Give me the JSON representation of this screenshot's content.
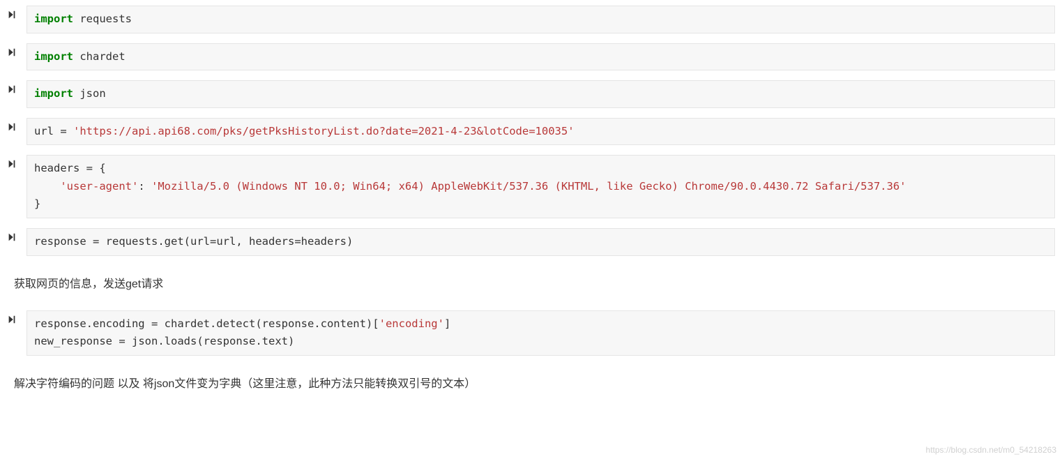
{
  "cells": [
    {
      "type": "code",
      "tokens": [
        {
          "t": "import ",
          "c": "kw-import"
        },
        {
          "t": "requests",
          "c": "kw-plain"
        }
      ]
    },
    {
      "type": "code",
      "tokens": [
        {
          "t": "import ",
          "c": "kw-import"
        },
        {
          "t": "chardet",
          "c": "kw-plain"
        }
      ]
    },
    {
      "type": "code",
      "tokens": [
        {
          "t": "import ",
          "c": "kw-import"
        },
        {
          "t": "json",
          "c": "kw-plain"
        }
      ]
    },
    {
      "type": "code",
      "tokens": [
        {
          "t": "url ",
          "c": "kw-plain"
        },
        {
          "t": "= ",
          "c": "op"
        },
        {
          "t": "'https://api.api68.com/pks/getPksHistoryList.do?date=2021-4-23&lotCode=10035'",
          "c": "str"
        }
      ]
    },
    {
      "type": "code",
      "tokens": [
        {
          "t": "headers ",
          "c": "kw-plain"
        },
        {
          "t": "= {",
          "c": "op"
        },
        {
          "t": "\n",
          "c": "kw-plain"
        },
        {
          "t": "    ",
          "c": "kw-plain"
        },
        {
          "t": "'user-agent'",
          "c": "str"
        },
        {
          "t": ": ",
          "c": "op"
        },
        {
          "t": "'Mozilla/5.0 (Windows NT 10.0; Win64; x64) AppleWebKit/537.36 (KHTML, like Gecko) Chrome/90.0.4430.72 Safari/537.36'",
          "c": "str"
        },
        {
          "t": "\n",
          "c": "kw-plain"
        },
        {
          "t": "}",
          "c": "op"
        }
      ]
    },
    {
      "type": "code",
      "tokens": [
        {
          "t": "response ",
          "c": "kw-plain"
        },
        {
          "t": "= ",
          "c": "op"
        },
        {
          "t": "requests.get",
          "c": "kw-plain"
        },
        {
          "t": "(",
          "c": "paren"
        },
        {
          "t": "url",
          "c": "kw-plain"
        },
        {
          "t": "=",
          "c": "op"
        },
        {
          "t": "url, headers",
          "c": "kw-plain"
        },
        {
          "t": "=",
          "c": "op"
        },
        {
          "t": "headers",
          "c": "kw-plain"
        },
        {
          "t": ")",
          "c": "paren"
        }
      ]
    },
    {
      "type": "markdown",
      "text": "获取网页的信息，发送get请求"
    },
    {
      "type": "code",
      "tokens": [
        {
          "t": "response.encoding ",
          "c": "kw-plain"
        },
        {
          "t": "= ",
          "c": "op"
        },
        {
          "t": "chardet.detect",
          "c": "kw-plain"
        },
        {
          "t": "(",
          "c": "paren"
        },
        {
          "t": "response.content",
          "c": "kw-plain"
        },
        {
          "t": ")[",
          "c": "paren"
        },
        {
          "t": "'encoding'",
          "c": "str"
        },
        {
          "t": "]",
          "c": "paren"
        },
        {
          "t": "\n",
          "c": "kw-plain"
        },
        {
          "t": "new_response ",
          "c": "kw-plain"
        },
        {
          "t": "= ",
          "c": "op"
        },
        {
          "t": "json.loads",
          "c": "kw-plain"
        },
        {
          "t": "(",
          "c": "paren"
        },
        {
          "t": "response.text",
          "c": "kw-plain"
        },
        {
          "t": ")",
          "c": "paren"
        }
      ]
    },
    {
      "type": "markdown",
      "text": "解决字符编码的问题 以及 将json文件变为字典（这里注意，此种方法只能转换双引号的文本）"
    }
  ],
  "watermark": "https://blog.csdn.net/m0_54218263",
  "icon_name": "run-cell-icon"
}
